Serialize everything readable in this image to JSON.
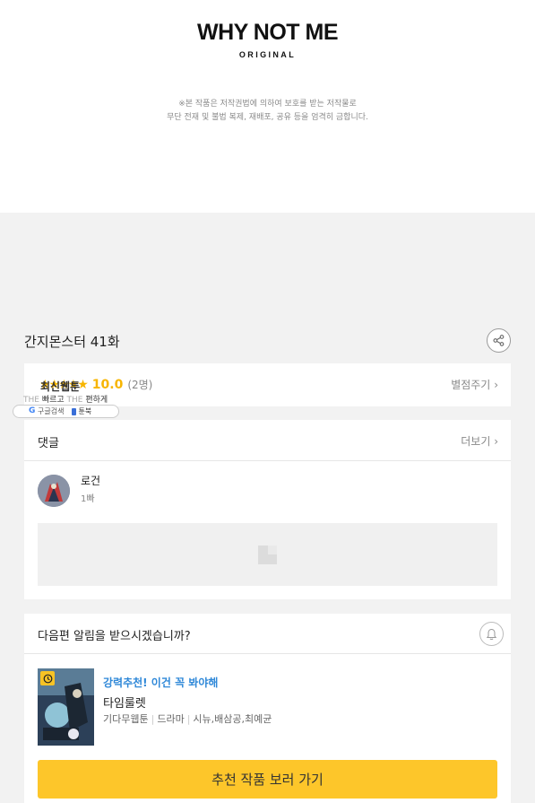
{
  "brand": {
    "logo": "WHY NOT ME",
    "logo_sub": "ORIGINAL"
  },
  "notice": {
    "line1": "※본 작품은 저작권법에 의하여 보호를 받는 저작물로",
    "line2": "무단 전재 및 불법 복제, 재배포, 공유 등을 엄격히 금합니다."
  },
  "episode": {
    "title": "간지몬스터 41화",
    "share_icon": "share-icon"
  },
  "rating": {
    "stars": "★★★★★",
    "score": "10.0",
    "votes": "(2명)",
    "rate_button": "별점주기",
    "overlay_label": "최신웹툰",
    "overlay_slogan_a": "THE",
    "overlay_slogan_b": "빠르고",
    "overlay_slogan_c": "THE",
    "overlay_slogan_d": "편하게",
    "search_engine": "구글검색",
    "search_site": "툰북",
    "accent": "#f7b500"
  },
  "comments": {
    "title": "댓글",
    "more": "더보기",
    "items": [
      {
        "name": "로건",
        "time": "1빠"
      }
    ]
  },
  "next": {
    "question": "다음편 알림을 받으시겠습니까?",
    "recommendation": {
      "tag": "강력추천! 이건 꼭 봐야해",
      "title": "타임룰렛",
      "studio": "기다무웹툰",
      "genre": "드라마",
      "authors": "시뉴,배삼공,최예균"
    },
    "cta": "추천 작품 보러 가기",
    "cta_color": "#fdc62a",
    "tag_color": "#2f88d8"
  }
}
